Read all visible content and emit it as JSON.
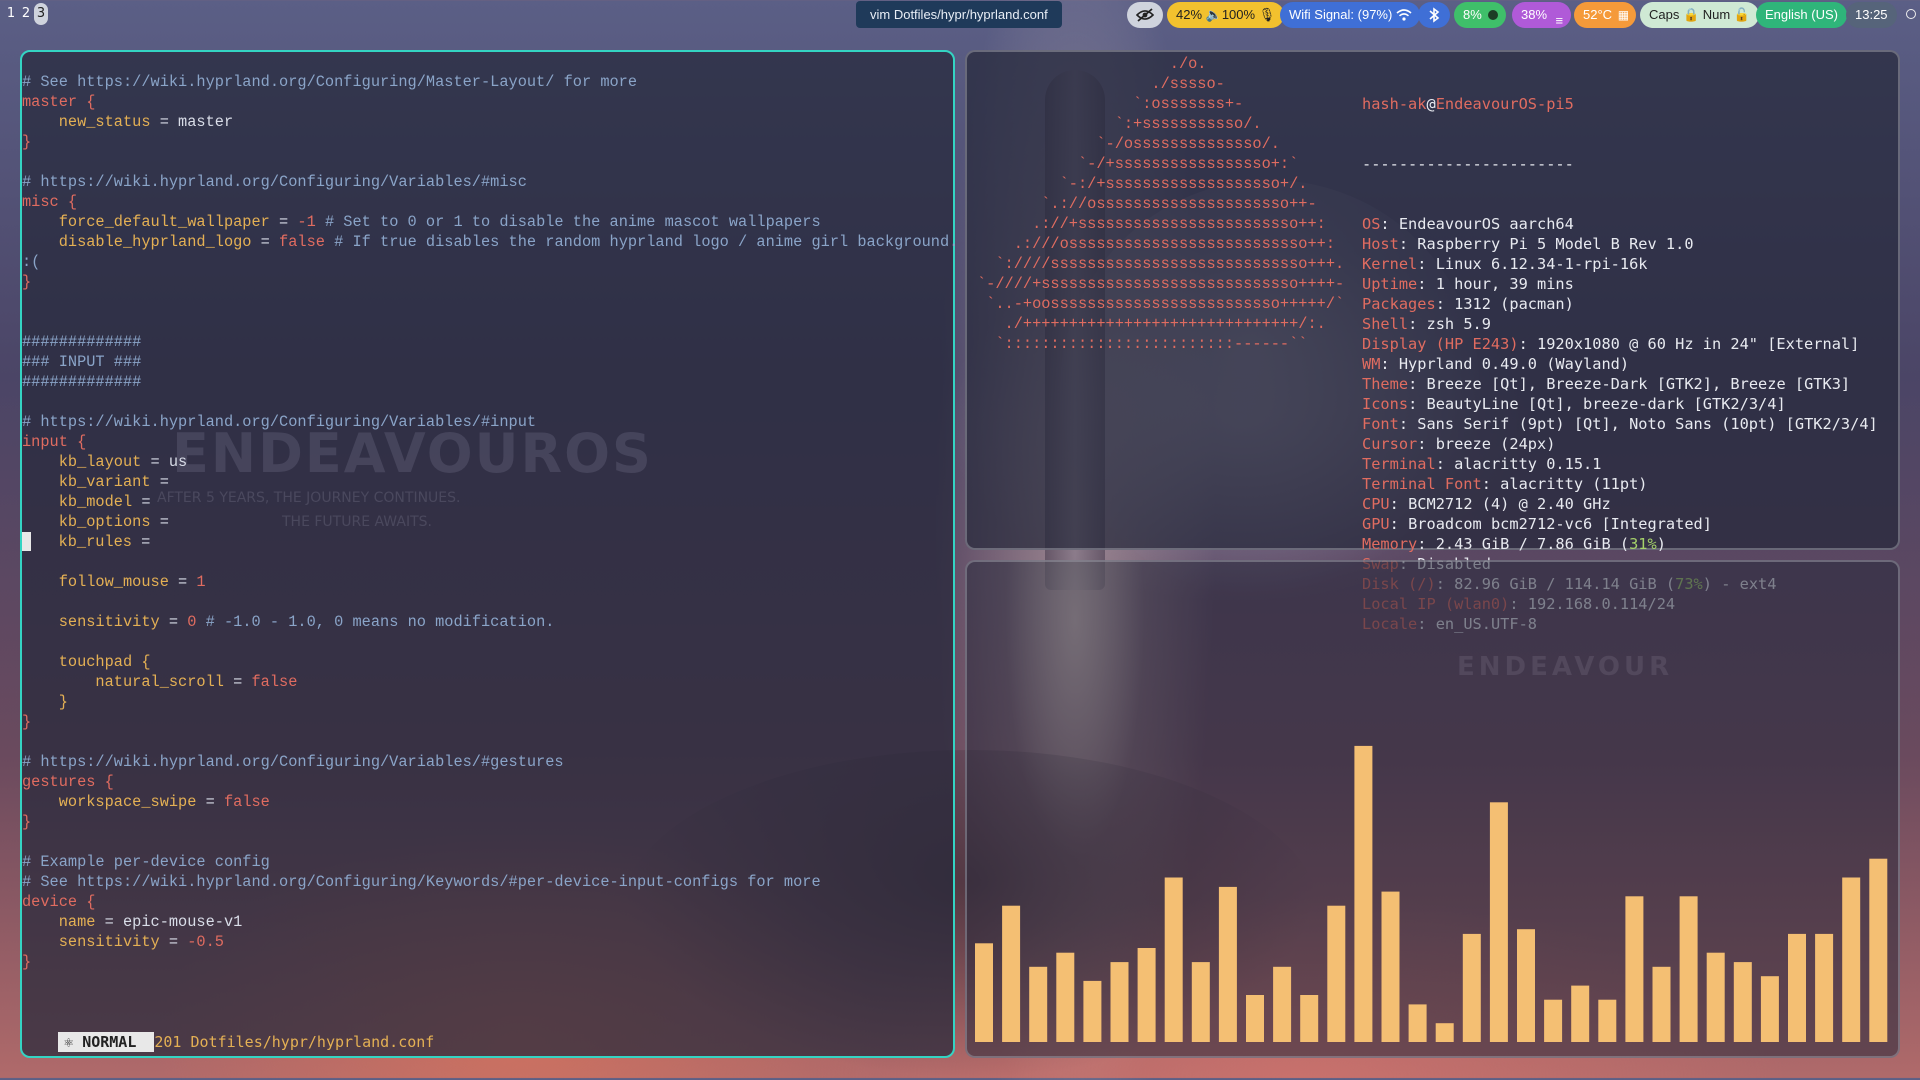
{
  "topbar": {
    "workspaces": [
      "1",
      "2",
      "3"
    ],
    "active_workspace": "3",
    "window_title": "vim Dotfiles/hypr/hyprland.conf",
    "modules": [
      {
        "name": "idle-inhibitor",
        "text": "",
        "icon": "eye-off-icon",
        "bg": "#cfd3dd",
        "fg": "#222222"
      },
      {
        "name": "brightness-volume",
        "text": "42% 🔈100% 🎙",
        "bg": "#f2c12e",
        "fg": "#222222"
      },
      {
        "name": "wifi",
        "text": "Wifi Signal: (97%)",
        "bg": "#3f6fd6",
        "fg": "#ffffff"
      },
      {
        "name": "bluetooth",
        "text": "",
        "icon": "bluetooth-icon",
        "bg": "#3f6fd6",
        "fg": "#ffffff"
      },
      {
        "name": "cpu",
        "text": "8%",
        "bg": "#3fbf6a",
        "fg": "#ffffff"
      },
      {
        "name": "memory",
        "text": "38%",
        "bg": "#b05ad8",
        "fg": "#ffffff"
      },
      {
        "name": "temperature",
        "text": "52°C",
        "bg": "#f59a3a",
        "fg": "#ffffff"
      },
      {
        "name": "lock-keys",
        "text": "Caps 🔒 Num 🔓",
        "bg": "#cfe9d4",
        "fg": "#222222"
      },
      {
        "name": "keyboard-layout",
        "text": "English (US)",
        "bg": "#2fb57a",
        "fg": "#ffffff"
      },
      {
        "name": "clock",
        "text": "13:25",
        "bg": "#56647a",
        "fg": "#ffffff"
      }
    ]
  },
  "vim": {
    "lines": [
      [
        [
          "c-com",
          "# See https://wiki.hyprland.org/Configuring/Master-Layout/ for more"
        ]
      ],
      [
        [
          "c-kw",
          "master {"
        ]
      ],
      [
        [
          "c-key",
          "    new_status"
        ],
        [
          "c-val",
          " = master"
        ]
      ],
      [
        [
          "c-kw",
          "}"
        ]
      ],
      [
        [
          "",
          ""
        ]
      ],
      [
        [
          "c-com",
          "# https://wiki.hyprland.org/Configuring/Variables/#misc"
        ]
      ],
      [
        [
          "c-kw",
          "misc {"
        ]
      ],
      [
        [
          "c-key",
          "    force_default_wallpaper"
        ],
        [
          "c-val",
          " = "
        ],
        [
          "c-num",
          "-1"
        ],
        [
          "c-com",
          " # Set to 0 or 1 to disable the anime mascot wallpapers"
        ]
      ],
      [
        [
          "c-key",
          "    disable_hyprland_logo"
        ],
        [
          "c-val",
          " = "
        ],
        [
          "c-num",
          "false"
        ],
        [
          "c-com",
          " # If true disables the random hyprland logo / anime girl background."
        ]
      ],
      [
        [
          "c-com",
          ":("
        ]
      ],
      [
        [
          "c-kw",
          "}"
        ]
      ],
      [
        [
          "",
          ""
        ]
      ],
      [
        [
          "",
          ""
        ]
      ],
      [
        [
          "c-hash",
          "#############"
        ]
      ],
      [
        [
          "c-hash",
          "### INPUT ###"
        ]
      ],
      [
        [
          "c-hash",
          "#############"
        ]
      ],
      [
        [
          "",
          ""
        ]
      ],
      [
        [
          "c-com",
          "# https://wiki.hyprland.org/Configuring/Variables/#input"
        ]
      ],
      [
        [
          "c-kw",
          "input {"
        ]
      ],
      [
        [
          "c-key",
          "    kb_layout"
        ],
        [
          "c-val",
          " = us"
        ]
      ],
      [
        [
          "c-key",
          "    kb_variant"
        ],
        [
          "c-val",
          " ="
        ]
      ],
      [
        [
          "c-key",
          "    kb_model"
        ],
        [
          "c-val",
          " ="
        ]
      ],
      [
        [
          "c-key",
          "    kb_options"
        ],
        [
          "c-val",
          " ="
        ]
      ],
      [
        [
          "cursor",
          " "
        ],
        [
          "c-key",
          "   kb_rules"
        ],
        [
          "c-val",
          " ="
        ]
      ],
      [
        [
          "",
          ""
        ]
      ],
      [
        [
          "c-key",
          "    follow_mouse"
        ],
        [
          "c-val",
          " = "
        ],
        [
          "c-num",
          "1"
        ]
      ],
      [
        [
          "",
          ""
        ]
      ],
      [
        [
          "c-key",
          "    sensitivity"
        ],
        [
          "c-val",
          " = "
        ],
        [
          "c-num",
          "0"
        ],
        [
          "c-com",
          " # -1.0 - 1.0, 0 means no modification."
        ]
      ],
      [
        [
          "",
          ""
        ]
      ],
      [
        [
          "c-key",
          "    touchpad {"
        ]
      ],
      [
        [
          "c-key",
          "        natural_scroll"
        ],
        [
          "c-val",
          " = "
        ],
        [
          "c-num",
          "false"
        ]
      ],
      [
        [
          "c-key",
          "    }"
        ]
      ],
      [
        [
          "c-kw",
          "}"
        ]
      ],
      [
        [
          "",
          ""
        ]
      ],
      [
        [
          "c-com",
          "# https://wiki.hyprland.org/Configuring/Variables/#gestures"
        ]
      ],
      [
        [
          "c-kw",
          "gestures {"
        ]
      ],
      [
        [
          "c-key",
          "    workspace_swipe"
        ],
        [
          "c-val",
          " = "
        ],
        [
          "c-num",
          "false"
        ]
      ],
      [
        [
          "c-kw",
          "}"
        ]
      ],
      [
        [
          "",
          ""
        ]
      ],
      [
        [
          "c-com",
          "# Example per-device config"
        ]
      ],
      [
        [
          "c-com",
          "# See https://wiki.hyprland.org/Configuring/Keywords/#per-device-input-configs for more"
        ]
      ],
      [
        [
          "c-kw",
          "device {"
        ]
      ],
      [
        [
          "c-key",
          "    name"
        ],
        [
          "c-val",
          " = epic-mouse-v1"
        ]
      ],
      [
        [
          "c-key",
          "    sensitivity"
        ],
        [
          "c-val",
          " = "
        ],
        [
          "c-num",
          "-0.5"
        ]
      ],
      [
        [
          "c-kw",
          "}"
        ]
      ]
    ],
    "mode": "NORMAL",
    "status_file": "201 Dotfiles/hypr/hyprland.conf"
  },
  "fastfetch": {
    "ascii": "                     ./o.\n                   ./sssso-\n                 `:osssssss+-\n               `:+sssssssssso/.\n             `-/ossssssssssssso/.\n           `-/+sssssssssssssssso+:`\n         `-:/+sssssssssssssssssso+/.\n       `.://osssssssssssssssssssso++-\n      .://+ssssssssssssssssssssssso++:\n    .:///ossssssssssssssssssssssssso++:\n  `:////ssssssssssssssssssssssssssso+++.\n`-////+ssssssssssssssssssssssssssso++++-\n `..-+oosssssssssssssssssssssssso+++++/`\n   ./++++++++++++++++++++++++++++++/:.\n  `:::::::::::::::::::::::::------``",
    "user": "hash-ak",
    "host": "EndeavourOS-pi5",
    "separator": "-----------------------",
    "rows": [
      {
        "label": "OS",
        "value": "EndeavourOS aarch64"
      },
      {
        "label": "Host",
        "value": "Raspberry Pi 5 Model B Rev 1.0"
      },
      {
        "label": "Kernel",
        "value": "Linux 6.12.34-1-rpi-16k"
      },
      {
        "label": "Uptime",
        "value": "1 hour, 39 mins"
      },
      {
        "label": "Packages",
        "value": "1312 (pacman)"
      },
      {
        "label": "Shell",
        "value": "zsh 5.9"
      },
      {
        "label": "Display (HP E243)",
        "value": "1920x1080 @ 60 Hz in 24\" [External]"
      },
      {
        "label": "WM",
        "value": "Hyprland 0.49.0 (Wayland)"
      },
      {
        "label": "Theme",
        "value": "Breeze [Qt], Breeze-Dark [GTK2], Breeze [GTK3]"
      },
      {
        "label": "Icons",
        "value": "BeautyLine [Qt], breeze-dark [GTK2/3/4]"
      },
      {
        "label": "Font",
        "value": "Sans Serif (9pt) [Qt], Noto Sans (10pt) [GTK2/3/4]"
      },
      {
        "label": "Cursor",
        "value": "breeze (24px)"
      },
      {
        "label": "Terminal",
        "value": "alacritty 0.15.1"
      },
      {
        "label": "Terminal Font",
        "value": "alacritty (11pt)"
      },
      {
        "label": "CPU",
        "value": "BCM2712 (4) @ 2.40 GHz"
      },
      {
        "label": "GPU",
        "value": "Broadcom bcm2712-vc6 [Integrated]"
      },
      {
        "label": "Memory",
        "value": "2.43 GiB / 7.86 GiB (",
        "pct": "31%",
        "tail": ")"
      },
      {
        "label": "Swap",
        "value": "Disabled"
      },
      {
        "label": "Disk (/)",
        "value": "82.96 GiB / 114.14 GiB (",
        "pct": "73%",
        "tail": ") - ext4"
      },
      {
        "label": "Local IP (wlan0)",
        "value": "192.168.0.114/24"
      },
      {
        "label": "Locale",
        "value": "en_US.UTF-8"
      }
    ]
  },
  "visualizer": {
    "bar_color": "#f4bf73",
    "levels": [
      0.21,
      0.29,
      0.16,
      0.19,
      0.13,
      0.17,
      0.2,
      0.35,
      0.17,
      0.33,
      0.1,
      0.16,
      0.1,
      0.29,
      0.63,
      0.32,
      0.08,
      0.04,
      0.23,
      0.51,
      0.24,
      0.09,
      0.12,
      0.09,
      0.31,
      0.16,
      0.31,
      0.19,
      0.17,
      0.14,
      0.23,
      0.23,
      0.35,
      0.39
    ]
  },
  "wallpaper": {
    "logo_text": "ENDEAVOUROS",
    "tagline": "AFTER 5 YEARS, THE JOURNEY CONTINUES.",
    "tagline2": "THE FUTURE AWAITS."
  }
}
